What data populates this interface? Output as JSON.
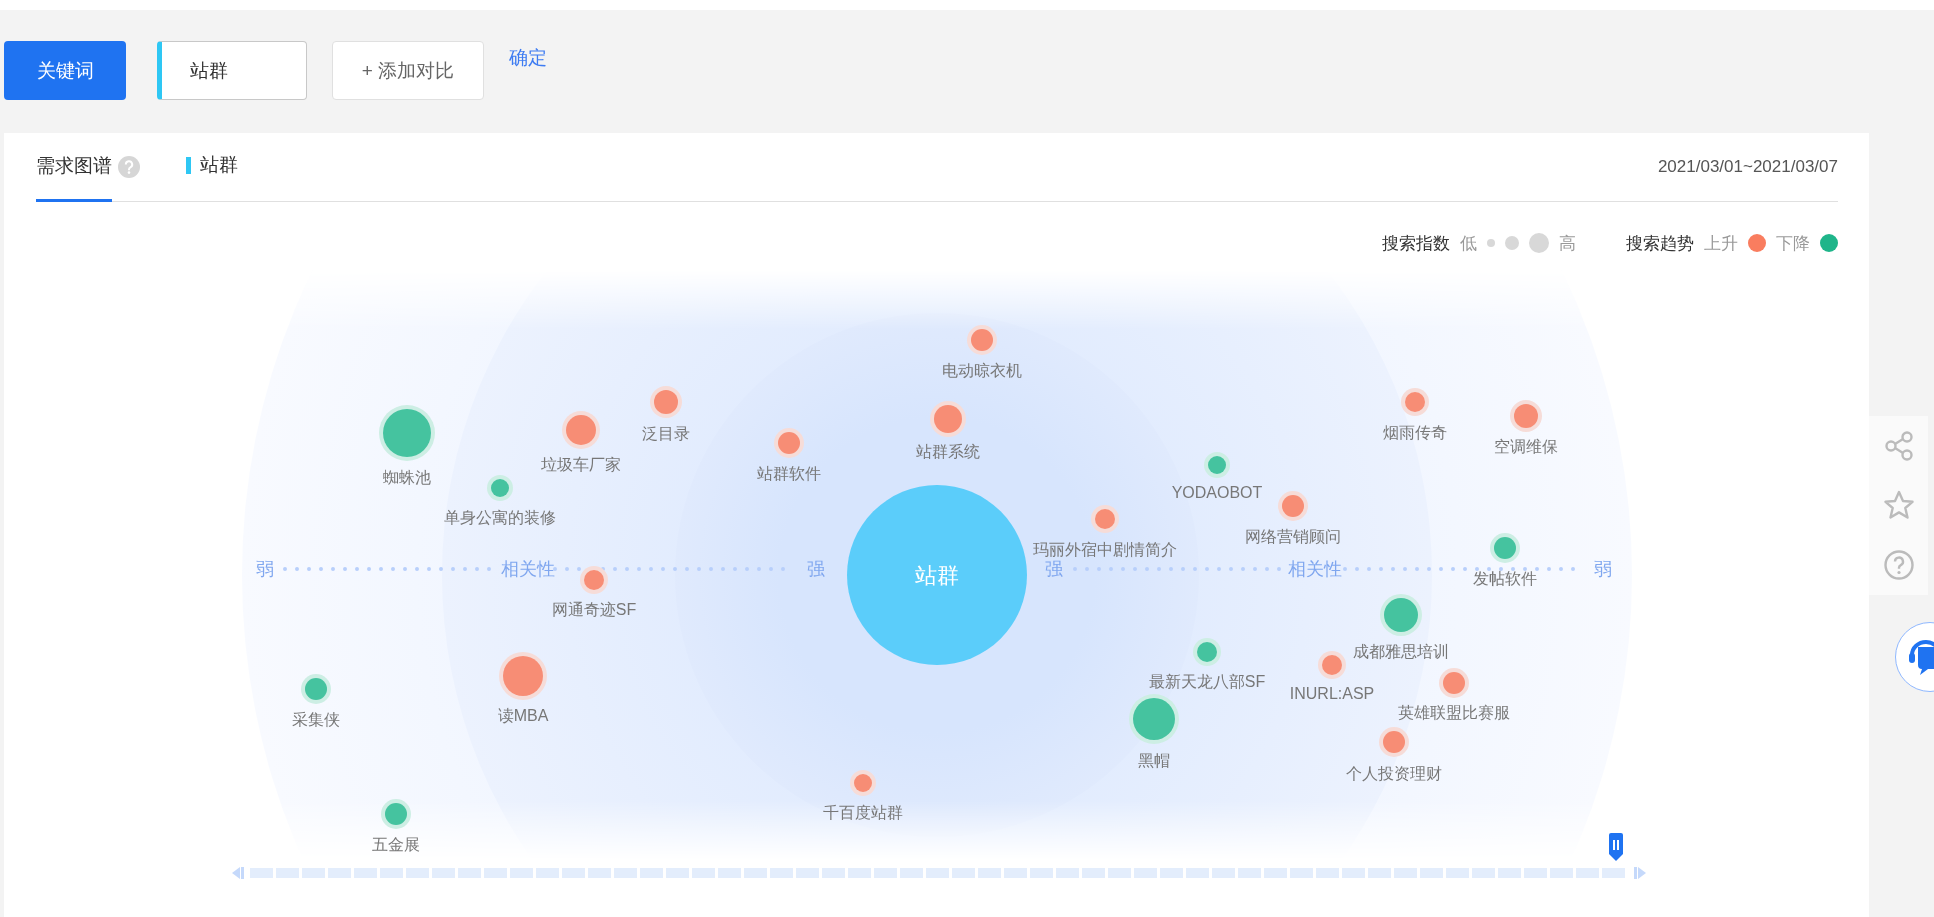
{
  "toolbar": {
    "keyword_button": "关键词",
    "keyword_input": "站群",
    "add_compare": "+ 添加对比",
    "confirm": "确定"
  },
  "tabs": [
    {
      "label": "需求图谱",
      "selected": true
    }
  ],
  "series_label": "站群",
  "date_range": "2021/03/01~2021/03/07",
  "legend": {
    "index_title": "搜索指数",
    "low": "低",
    "high": "高",
    "trend_title": "搜索趋势",
    "up": "上升",
    "down": "下降"
  },
  "center": "站群",
  "axis": {
    "left": [
      "弱",
      "相关性",
      "强"
    ],
    "right": [
      "强",
      "相关性",
      "弱"
    ]
  },
  "nodes": [
    {
      "label": "电动晾衣机",
      "rising": true
    },
    {
      "label": "泛目录",
      "rising": true
    },
    {
      "label": "烟雨传奇",
      "rising": true
    },
    {
      "label": "空调维保",
      "rising": true
    },
    {
      "label": "蜘蛛池",
      "rising": false
    },
    {
      "label": "垃圾车厂家",
      "rising": true
    },
    {
      "label": "站群软件",
      "rising": true
    },
    {
      "label": "站群系统",
      "rising": true
    },
    {
      "label": "YODAOBOT",
      "rising": false
    },
    {
      "label": "单身公寓的装修",
      "rising": false
    },
    {
      "label": "玛丽外宿中剧情简介",
      "rising": true
    },
    {
      "label": "网络营销顾问",
      "rising": true
    },
    {
      "label": "发帖软件",
      "rising": false
    },
    {
      "label": "网通奇迹SF",
      "rising": true
    },
    {
      "label": "成都雅思培训",
      "rising": false
    },
    {
      "label": "最新天龙八部SF",
      "rising": false
    },
    {
      "label": "INURL:ASP",
      "rising": true
    },
    {
      "label": "采集侠",
      "rising": false
    },
    {
      "label": "读MBA",
      "rising": true
    },
    {
      "label": "英雄联盟比赛服",
      "rising": true
    },
    {
      "label": "黑帽",
      "rising": false
    },
    {
      "label": "个人投资理财",
      "rising": true
    },
    {
      "label": "千百度站群",
      "rising": true
    },
    {
      "label": "五金展",
      "rising": false
    }
  ]
}
